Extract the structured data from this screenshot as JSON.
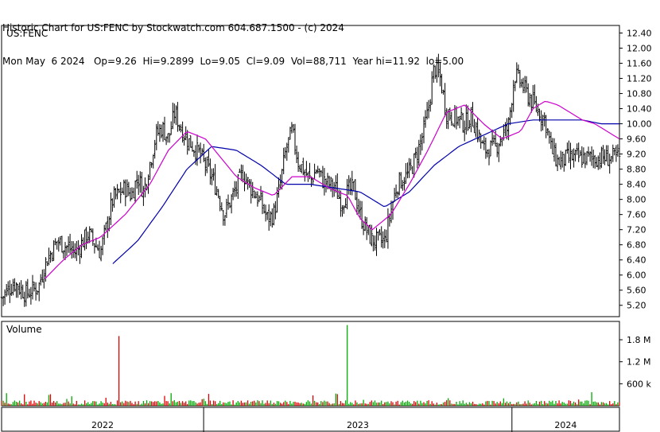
{
  "header": {
    "line1": "Historic Chart for US:FENC by Stockwatch.com 604.687.1500 - (c) 2024",
    "line2": "Mon May  6 2024   Op=9.26  Hi=9.2899  Lo=9.05  Cl=9.09  Vol=88,711  Year hi=11.92  lo=5.00"
  },
  "colors": {
    "price": "#000000",
    "ma_short": "#cc00cc",
    "ma_long": "#0000aa",
    "volume_up": "#00aa00",
    "volume_down": "#dd0000",
    "grid": "#000000"
  },
  "chart_data": [
    {
      "type": "line",
      "title": "US:FENC",
      "x_axis": {
        "labels": [
          "2022",
          "2023",
          "2024"
        ]
      },
      "y_axis": {
        "ticks": [
          "12.40",
          "12.00",
          "11.60",
          "11.20",
          "10.80",
          "10.40",
          "10.00",
          "9.60",
          "9.20",
          "8.80",
          "8.40",
          "8.00",
          "7.60",
          "7.20",
          "6.80",
          "6.40",
          "6.00",
          "5.60",
          "5.20"
        ],
        "ylim": [
          4.9,
          12.6
        ]
      },
      "series": [
        {
          "role": "price",
          "x": [
            0,
            0.02,
            0.04,
            0.06,
            0.07,
            0.09,
            0.12,
            0.14,
            0.16,
            0.18,
            0.2,
            0.21,
            0.22,
            0.23,
            0.25,
            0.26,
            0.27,
            0.28,
            0.29,
            0.3,
            0.32,
            0.34,
            0.35,
            0.36,
            0.38,
            0.39,
            0.4,
            0.42,
            0.43,
            0.44,
            0.45,
            0.46,
            0.47,
            0.48,
            0.5,
            0.51,
            0.52,
            0.54,
            0.55,
            0.56,
            0.57,
            0.58,
            0.59,
            0.6,
            0.62,
            0.63,
            0.64,
            0.66,
            0.67,
            0.68,
            0.69,
            0.7,
            0.71,
            0.72,
            0.74,
            0.75,
            0.76,
            0.77,
            0.78,
            0.8,
            0.81,
            0.82,
            0.83,
            0.84,
            0.85,
            0.87,
            0.88,
            0.89,
            0.9,
            0.92,
            0.93,
            0.94,
            0.95,
            0.96,
            0.97,
            0.98,
            0.99,
            1.0
          ],
          "y": [
            5.4,
            5.8,
            5.5,
            5.7,
            6.3,
            6.9,
            6.6,
            7.1,
            6.6,
            8.0,
            8.3,
            8.1,
            8.6,
            8.2,
            9.7,
            9.9,
            9.6,
            10.3,
            9.9,
            9.6,
            9.2,
            8.6,
            8.2,
            7.6,
            8.3,
            8.7,
            8.4,
            7.9,
            7.5,
            7.6,
            8.3,
            9.3,
            9.8,
            9.0,
            8.5,
            8.8,
            8.5,
            8.3,
            7.9,
            8.2,
            8.3,
            7.6,
            7.2,
            6.9,
            6.9,
            7.7,
            8.4,
            8.7,
            9.1,
            9.6,
            10.3,
            11.5,
            11.2,
            10.3,
            10.1,
            10.0,
            10.2,
            9.8,
            9.3,
            9.4,
            9.7,
            9.9,
            11.3,
            11.1,
            10.8,
            10.3,
            10.1,
            9.3,
            9.0,
            9.1,
            9.1,
            9.1,
            9.1,
            9.1,
            9.1,
            9.1,
            9.1,
            9.09
          ]
        },
        {
          "role": "moving-average-short",
          "x": [
            0.07,
            0.1,
            0.13,
            0.16,
            0.2,
            0.24,
            0.27,
            0.3,
            0.33,
            0.36,
            0.38,
            0.41,
            0.44,
            0.47,
            0.5,
            0.53,
            0.56,
            0.58,
            0.6,
            0.63,
            0.66,
            0.69,
            0.72,
            0.75,
            0.78,
            0.81,
            0.84,
            0.86,
            0.88,
            0.9,
            0.92,
            0.94,
            0.96,
            0.98,
            1.0
          ],
          "y": [
            5.9,
            6.4,
            6.8,
            7.0,
            7.6,
            8.4,
            9.3,
            9.8,
            9.6,
            9.0,
            8.6,
            8.3,
            8.1,
            8.6,
            8.6,
            8.3,
            8.1,
            7.5,
            7.2,
            7.6,
            8.4,
            9.3,
            10.3,
            10.5,
            10.0,
            9.6,
            9.8,
            10.4,
            10.6,
            10.5,
            10.3,
            10.1,
            10.0,
            9.8,
            9.6
          ]
        },
        {
          "role": "moving-average-long",
          "x": [
            0.18,
            0.22,
            0.26,
            0.3,
            0.34,
            0.38,
            0.42,
            0.46,
            0.5,
            0.54,
            0.58,
            0.62,
            0.66,
            0.7,
            0.74,
            0.78,
            0.82,
            0.86,
            0.9,
            0.94,
            0.97,
            1.0
          ],
          "y": [
            6.3,
            6.9,
            7.8,
            8.8,
            9.4,
            9.3,
            8.9,
            8.4,
            8.4,
            8.3,
            8.2,
            7.8,
            8.2,
            8.9,
            9.4,
            9.7,
            10.0,
            10.1,
            10.1,
            10.1,
            10.0,
            10.0
          ]
        }
      ]
    },
    {
      "type": "bar",
      "title": "Volume",
      "y_axis": {
        "ticks": [
          "1.8 M",
          "1.2 M",
          "600 k"
        ]
      },
      "highlights": [
        {
          "x": 0.19,
          "value": 1.9
        },
        {
          "x": 0.56,
          "value": 2.2
        }
      ]
    }
  ]
}
